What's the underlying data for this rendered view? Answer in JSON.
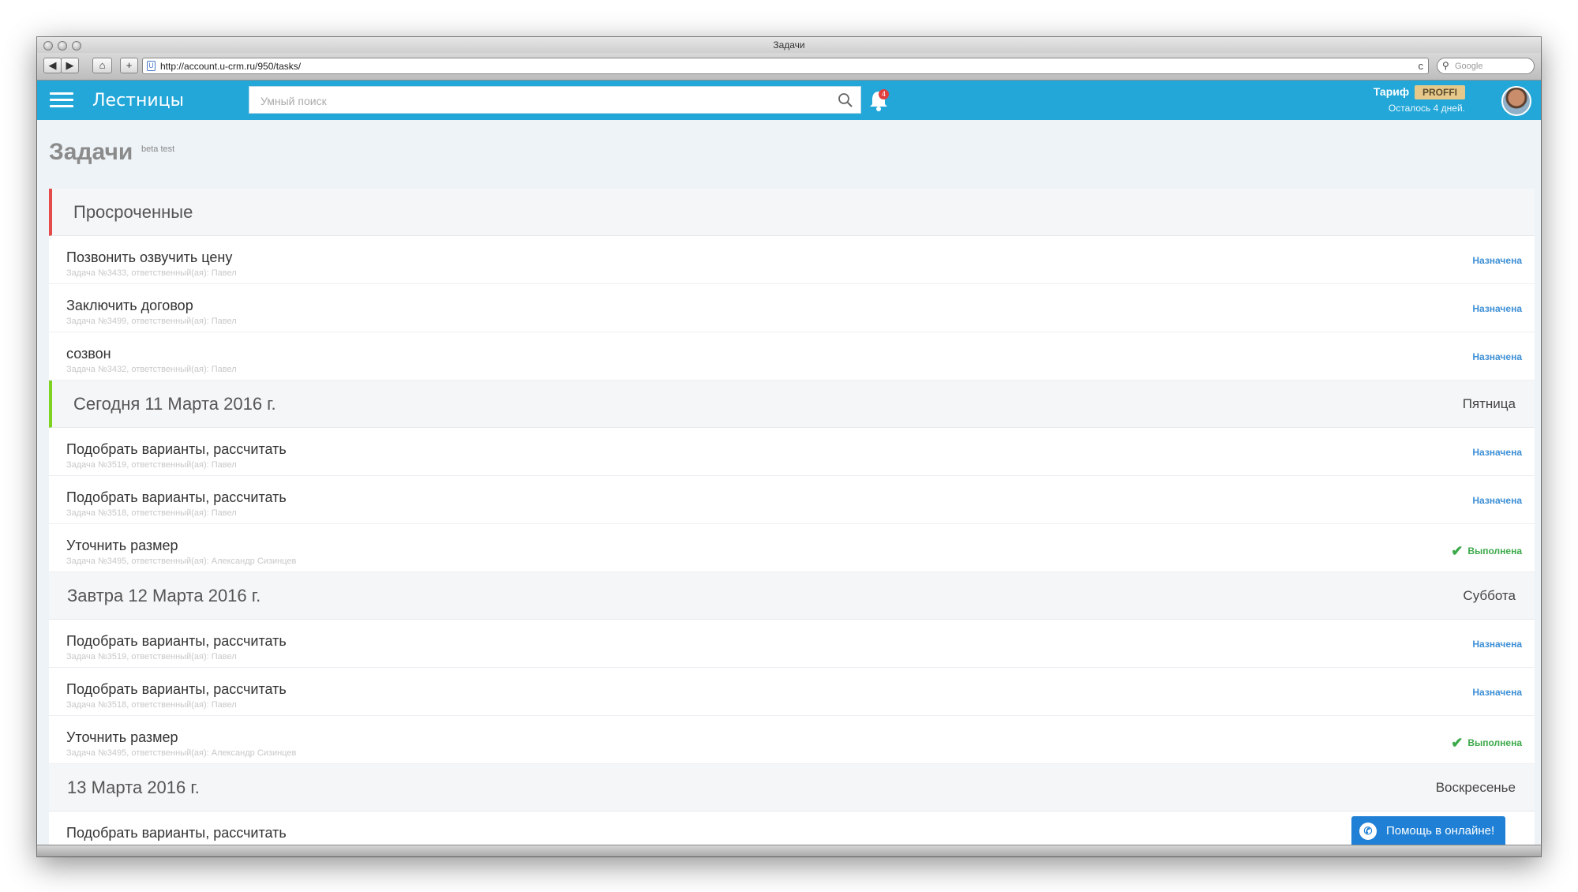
{
  "window": {
    "title": "Задачи",
    "url": "http://account.u-crm.ru/950/tasks/",
    "search_placeholder": "Google",
    "nav_back": "◀",
    "nav_forward": "▶",
    "home": "⌂",
    "add": "+",
    "reload": "c"
  },
  "appbar": {
    "brand": "Лестницы",
    "search_placeholder": "Умный поиск",
    "notifications_count": "4",
    "tariff_label": "Тариф",
    "tariff_plan": "PROFFI",
    "days_left": "Осталось 4 дней."
  },
  "page": {
    "title": "Задачи",
    "badge": "beta test"
  },
  "groups": [
    {
      "title": "Просроченные",
      "day": "",
      "tasks": [
        {
          "title": "Позвонить озвучить цену",
          "meta": "Задача №3433, ответственный(ая): Павел",
          "status": "Назначена"
        },
        {
          "title": "Заключить договор",
          "meta": "Задача №3499, ответственный(ая): Павел",
          "status": "Назначена"
        },
        {
          "title": "созвон",
          "meta": "Задача №3432, ответственный(ая): Павел",
          "status": "Назначена"
        }
      ]
    },
    {
      "title": "Сегодня 11 Марта 2016 г.",
      "day": "Пятница",
      "tasks": [
        {
          "title": "Подобрать варианты, рассчитать",
          "meta": "Задача №3519, ответственный(ая): Павел",
          "status": "Назначена"
        },
        {
          "title": "Подобрать варианты, рассчитать",
          "meta": "Задача №3518, ответственный(ая): Павел",
          "status": "Назначена"
        },
        {
          "title": "Уточнить размер",
          "meta": "Задача №3495, ответственный(ая): Александр Сизинцев",
          "status": "Выполнена"
        }
      ]
    },
    {
      "title": "Завтра 12 Марта 2016 г.",
      "day": "Суббота",
      "tasks": [
        {
          "title": "Подобрать варианты, рассчитать",
          "meta": "Задача №3519, ответственный(ая): Павел",
          "status": "Назначена"
        },
        {
          "title": "Подобрать варианты, рассчитать",
          "meta": "Задача №3518, ответственный(ая): Павел",
          "status": "Назначена"
        },
        {
          "title": "Уточнить размер",
          "meta": "Задача №3495, ответственный(ая): Александр Сизинцев",
          "status": "Выполнена"
        }
      ]
    },
    {
      "title": "13 Марта 2016 г.",
      "day": "Воскресенье",
      "tasks": [
        {
          "title": "Подобрать варианты, рассчитать",
          "meta": "",
          "status": ""
        }
      ]
    }
  ],
  "help": {
    "label": "Помощь в онлайне!"
  }
}
